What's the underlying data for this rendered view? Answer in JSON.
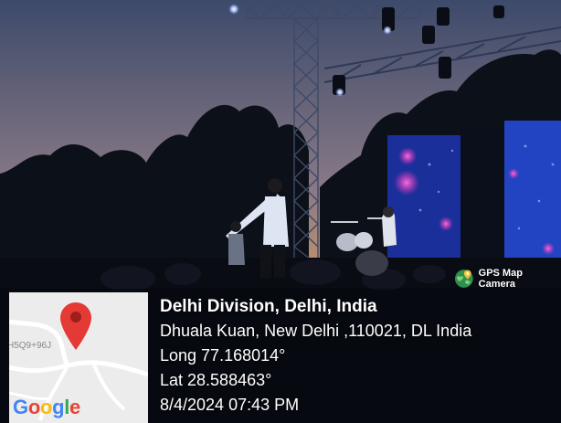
{
  "watermark": {
    "label": "GPS Map Camera",
    "icon": "globe-pin-icon"
  },
  "minimap": {
    "plus_code": "H5Q9+96J",
    "logo_letters": [
      {
        "char": "G",
        "color": "#4285F4"
      },
      {
        "char": "o",
        "color": "#EA4335"
      },
      {
        "char": "o",
        "color": "#FBBC05"
      },
      {
        "char": "g",
        "color": "#4285F4"
      },
      {
        "char": "l",
        "color": "#34A853"
      },
      {
        "char": "e",
        "color": "#EA4335"
      }
    ],
    "pin_color": "#E53935"
  },
  "location": {
    "title": "Delhi Division, Delhi, India",
    "address": "Dhuala Kuan, New Delhi ,110021, DL India",
    "longitude": "Long 77.168014°",
    "latitude": "Lat 28.588463°",
    "datetime": "8/4/2024 07:43 PM"
  },
  "colors": {
    "sky_top": "#3a4a6e",
    "sky_bottom": "#e8a05c",
    "screen_blue": "#1a3fb0",
    "screen_magenta": "#ff3ec8",
    "stage_light": "#d8e4ff",
    "text": "#ffffff"
  }
}
